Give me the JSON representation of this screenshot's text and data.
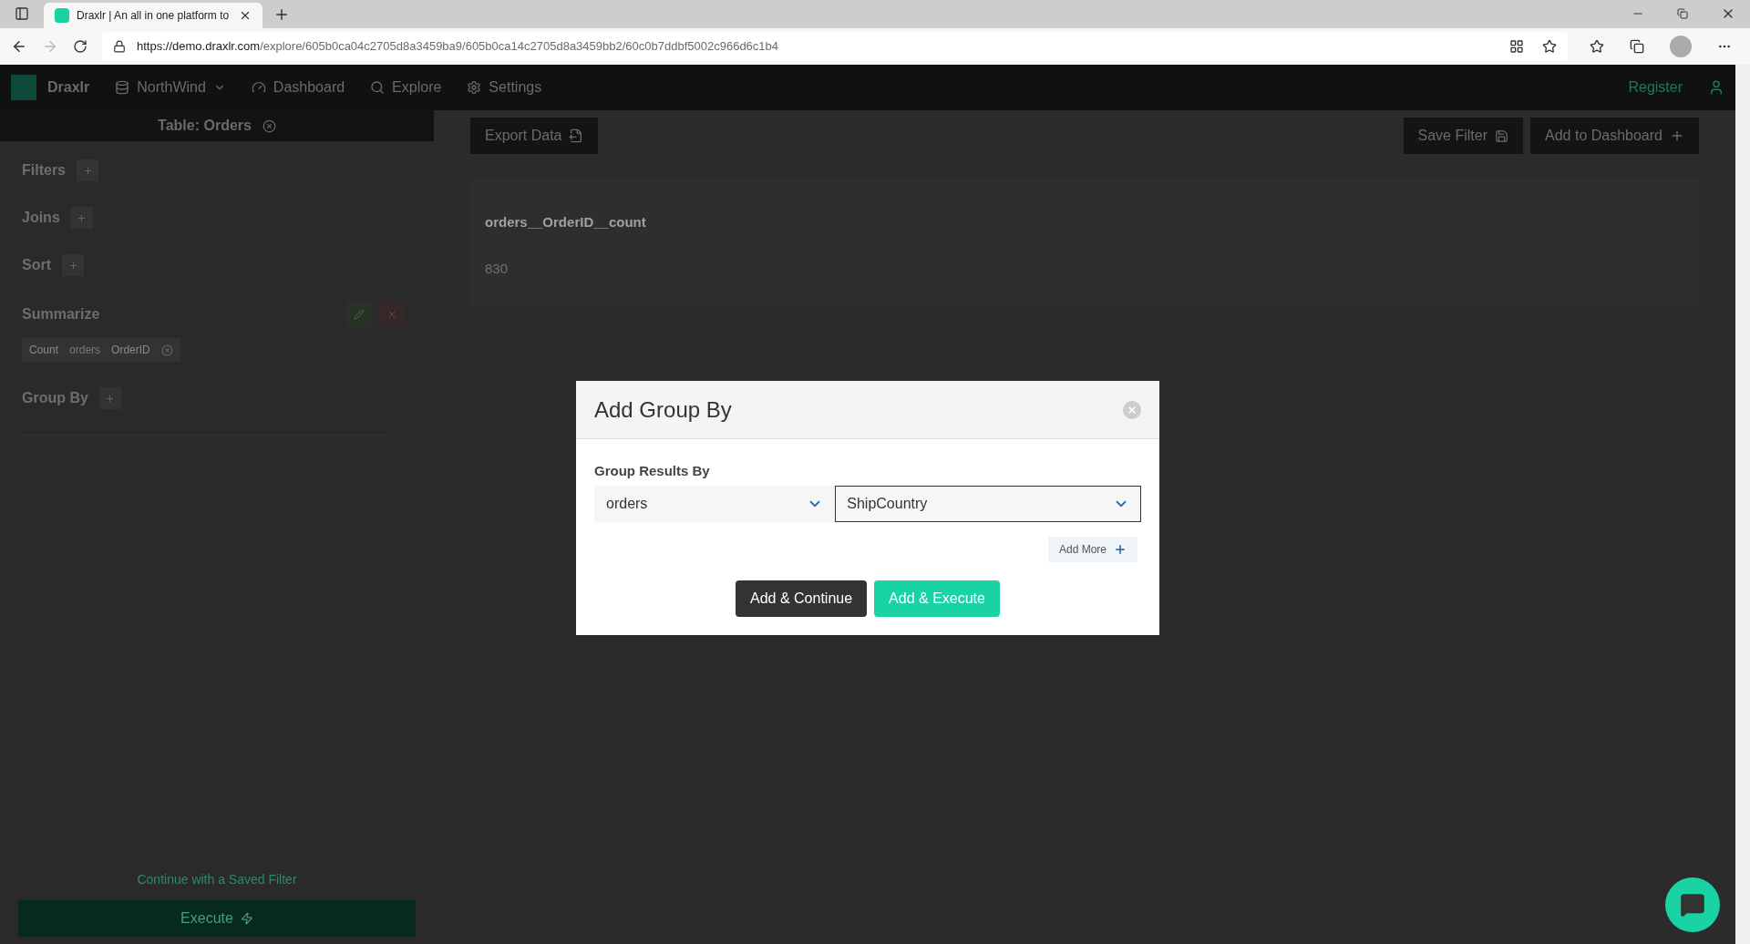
{
  "browser": {
    "tab_title": "Draxlr | An all in one platform to",
    "url_host": "https://demo.draxlr.com",
    "url_path": "/explore/605b0ca04c2705d8a3459ba9/605b0ca14c2705d8a3459bb2/60c0b7ddbf5002c966d6c1b4"
  },
  "nav": {
    "brand": "Draxlr",
    "items": [
      {
        "label": "NorthWind",
        "kind": "database"
      },
      {
        "label": "Dashboard",
        "kind": "dashboard"
      },
      {
        "label": "Explore",
        "kind": "explore"
      },
      {
        "label": "Settings",
        "kind": "settings"
      }
    ],
    "register": "Register"
  },
  "sidebar": {
    "title": "Table: Orders",
    "sections": [
      {
        "label": "Filters",
        "kind": "add"
      },
      {
        "label": "Joins",
        "kind": "add"
      },
      {
        "label": "Sort",
        "kind": "add"
      },
      {
        "label": "Summarize",
        "kind": "summary",
        "chips": [
          "Count",
          "orders",
          "OrderID"
        ]
      },
      {
        "label": "Group By",
        "kind": "add"
      }
    ],
    "saved_filter_link": "Continue with a Saved Filter",
    "execute": "Execute"
  },
  "content": {
    "export": "Export Data",
    "save_filter": "Save Filter",
    "add_to_dashboard": "Add to Dashboard",
    "column": "orders__OrderID__count",
    "value": "830"
  },
  "modal": {
    "title": "Add Group By",
    "field_label": "Group Results By",
    "selects": [
      {
        "value": "orders",
        "focused": false
      },
      {
        "value": "ShipCountry",
        "focused": true
      }
    ],
    "add_more": "Add More",
    "buttons": [
      {
        "label": "Add & Continue",
        "kind": "dark"
      },
      {
        "label": "Add & Execute",
        "kind": "primary"
      }
    ]
  }
}
